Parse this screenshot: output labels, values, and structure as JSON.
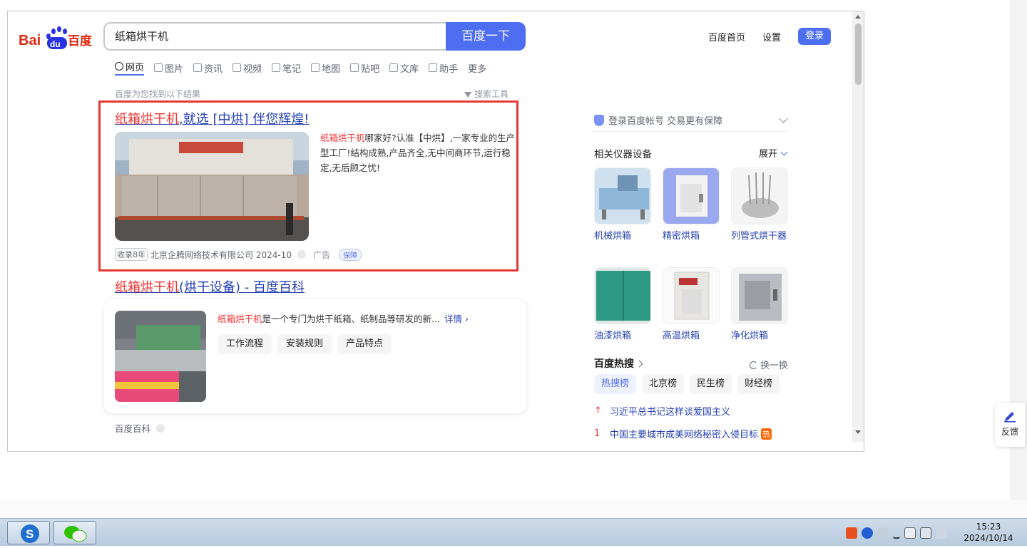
{
  "logo": {
    "text_bai": "Bai",
    "text_du": "du",
    "text_baidu_cn": "百度"
  },
  "search": {
    "query": "纸箱烘干机",
    "button_label": "百度一下"
  },
  "top_nav": {
    "home": "百度首页",
    "settings": "设置",
    "login": "登录"
  },
  "tabs": [
    {
      "label": "网页",
      "icon": "search-icon"
    },
    {
      "label": "图片",
      "icon": "image-icon"
    },
    {
      "label": "资讯",
      "icon": "news-icon"
    },
    {
      "label": "视频",
      "icon": "video-icon"
    },
    {
      "label": "笔记",
      "icon": "note-icon"
    },
    {
      "label": "地图",
      "icon": "map-icon"
    },
    {
      "label": "贴吧",
      "icon": "tieba-icon"
    },
    {
      "label": "文库",
      "icon": "doc-icon"
    },
    {
      "label": "助手",
      "icon": "ai-icon"
    },
    {
      "label": "更多",
      "icon": ""
    }
  ],
  "results_header": {
    "note": "百度为您找到以下结果",
    "tools": "搜索工具"
  },
  "ad_result": {
    "title_hl": "纸箱烘干机",
    "title_rest": ",就选 [中烘] 伴您辉煌!",
    "desc_hl": "纸箱烘干机",
    "desc_rest": "哪家好?认准【中烘】,一家专业的生产型工厂!结构成熟,产品齐全,无中间商环节,运行稳定,无后顾之忧!",
    "tag": "收录8年",
    "company_date": "北京企腾网络技术有限公司 2024-10",
    "ad_label": "广告",
    "guarantee": "保障"
  },
  "result2": {
    "title_hl": "纸箱烘干机",
    "title_rest": "(烘干设备) - 百度百科",
    "desc_hl": "纸箱烘干机",
    "desc_rest": "是一个专门为烘干纸箱、纸制品等研发的新...",
    "more": "详情",
    "chips": [
      "工作流程",
      "安装规则",
      "产品特点"
    ],
    "source": "百度百科"
  },
  "sidebar": {
    "login_tip": "登录百度帐号 交易更有保障",
    "related_title": "相关仪器设备",
    "expand": "展开",
    "items": [
      {
        "label": "机械烘箱",
        "color": "#8fb7d8"
      },
      {
        "label": "精密烘箱",
        "color": "#9aa8f0"
      },
      {
        "label": "列管式烘干器",
        "color": "#d9d9d9"
      },
      {
        "label": "油漆烘箱",
        "color": "#2e9a86"
      },
      {
        "label": "高温烘箱",
        "color": "#e8e6e2"
      },
      {
        "label": "净化烘箱",
        "color": "#b9bcc2"
      }
    ],
    "hot_title": "百度热搜",
    "refresh": "换一换",
    "hot_tabs": [
      "热搜榜",
      "北京榜",
      "民生榜",
      "财经榜"
    ],
    "hot_items": [
      {
        "rank": "↑",
        "text": "习近平总书记这样谈爱国主义",
        "badge": ""
      },
      {
        "rank": "1",
        "text": "中国主要城市成美网络秘密入侵目标",
        "badge": "热"
      }
    ]
  },
  "feedback": {
    "label": "反馈"
  },
  "taskbar": {
    "time": "15:23",
    "date": "2024/10/14"
  }
}
